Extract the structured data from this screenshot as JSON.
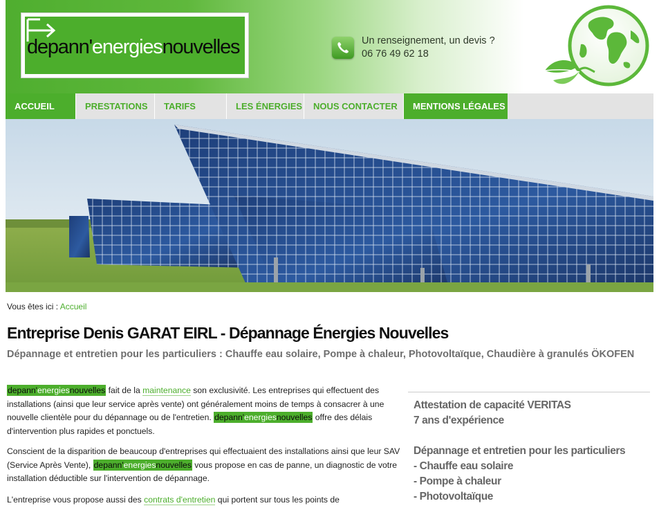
{
  "header": {
    "logo": {
      "part1": "depann'",
      "part2": "energies",
      "part3": "nouvelles"
    },
    "contact": {
      "line1": "Un renseignement, un devis ?",
      "phone": "06 76 49 62 18"
    }
  },
  "nav": {
    "items": [
      {
        "label": "ACCUEIL",
        "active": true
      },
      {
        "label": "PRESTATIONS",
        "active": false
      },
      {
        "label": "TARIFS",
        "active": false
      },
      {
        "label": "LES ÉNERGIES",
        "active": false
      },
      {
        "label": "NOUS CONTACTER",
        "active": false
      },
      {
        "label": "MENTIONS LÉGALES",
        "active": true
      }
    ]
  },
  "breadcrumb": {
    "prefix": "Vous êtes ici : ",
    "current": "Accueil"
  },
  "main": {
    "title": "Entreprise Denis GARAT EIRL - Dépannage Énergies Nouvelles",
    "subtitle": "Dépannage et entretien pour les particuliers : Chauffe eau solaire, Pompe à chaleur, Photovoltaïque, Chaudière à granulés ÖKOFEN",
    "brand": {
      "part1": "depann'",
      "part2": "energies",
      "part3": "nouvelles"
    },
    "p1": {
      "t1": " fait de la ",
      "link": "maintenance",
      "t2": " son exclusivité. Les entreprises qui effectuent des installations (ainsi que leur service après vente) ont généralement moins de temps à consacrer à une nouvelle clientèle pour du dépannage ou de l'entretien. ",
      "t3": " offre des délais d'intervention plus rapides et ponctuels."
    },
    "p2": {
      "t1": "Conscient de la disparition de beaucoup d'entreprises qui effectuaient des installations ainsi que leur SAV (Service Après Vente), ",
      "t2": " vous propose en cas de panne, un diagnostic de votre installation déductible sur l'intervention de dépannage."
    },
    "p3": {
      "t1": "L'entreprise vous propose aussi des ",
      "link": "contrats d'entretien",
      "t2": " qui portent sur tous les points de"
    }
  },
  "sidebar": {
    "lines": [
      "Attestation de capacité VERITAS",
      "7 ans d'expérience",
      "Dépannage et entretien pour les particuliers",
      "- Chauffe eau solaire",
      "- Pompe à chaleur",
      "- Photovoltaïque"
    ]
  },
  "colors": {
    "brand_green": "#4cae2c",
    "nav_bg": "#e3e3e3",
    "subtitle_gray": "#6e6e6e"
  },
  "icons": [
    "arrow-right-icon",
    "phone-icon",
    "globe-icon",
    "leaf-icon"
  ]
}
